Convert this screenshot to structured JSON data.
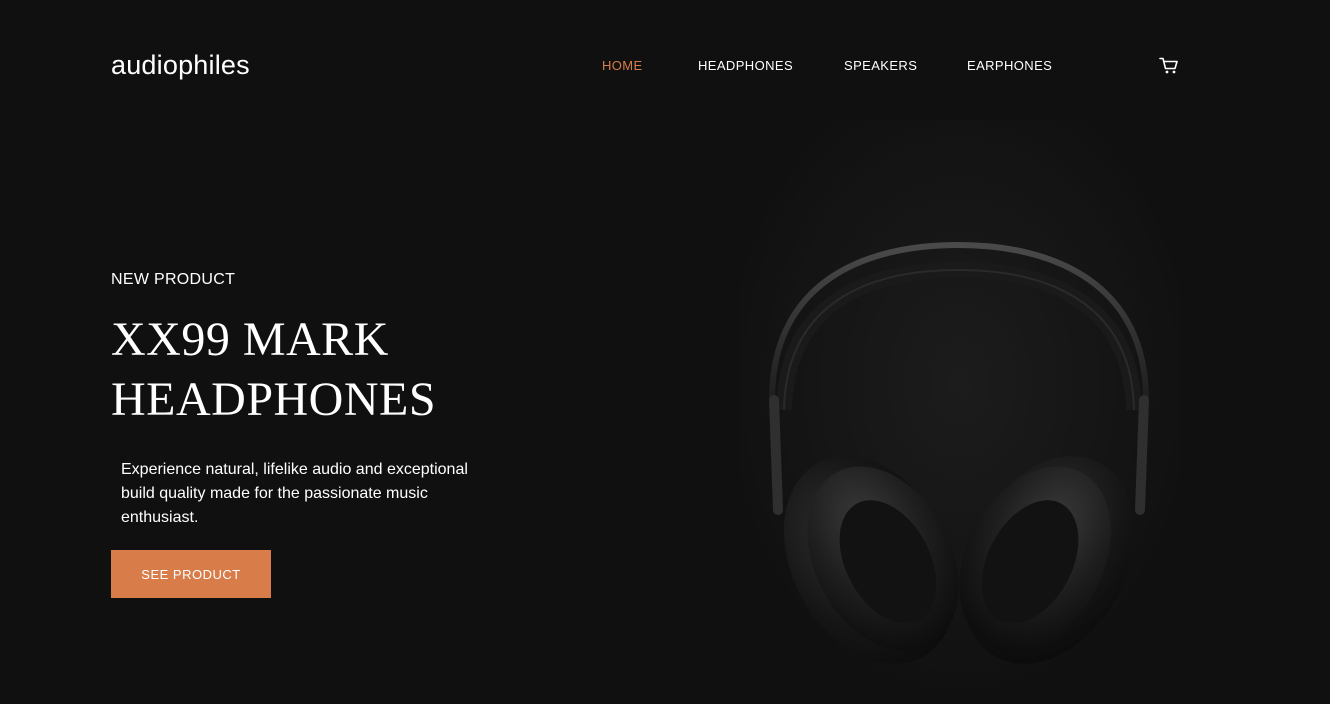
{
  "header": {
    "logo": "audiophiles",
    "nav": [
      {
        "label": "HOME",
        "active": true
      },
      {
        "label": "HEADPHONES",
        "active": false
      },
      {
        "label": "SPEAKERS",
        "active": false
      },
      {
        "label": "EARPHONES",
        "active": false
      }
    ],
    "cart_icon": "cart-icon"
  },
  "hero": {
    "eyebrow": "NEW PRODUCT",
    "title_line1": "XX99 MARK",
    "title_line2": "HEADPHONES",
    "description": "Experience natural, lifelike audio and exceptional build quality made for the passionate music enthusiast.",
    "cta_label": "SEE PRODUCT",
    "image": "headphones-image"
  },
  "colors": {
    "background": "#101010",
    "accent": "#d87d4a",
    "text": "#ffffff"
  }
}
